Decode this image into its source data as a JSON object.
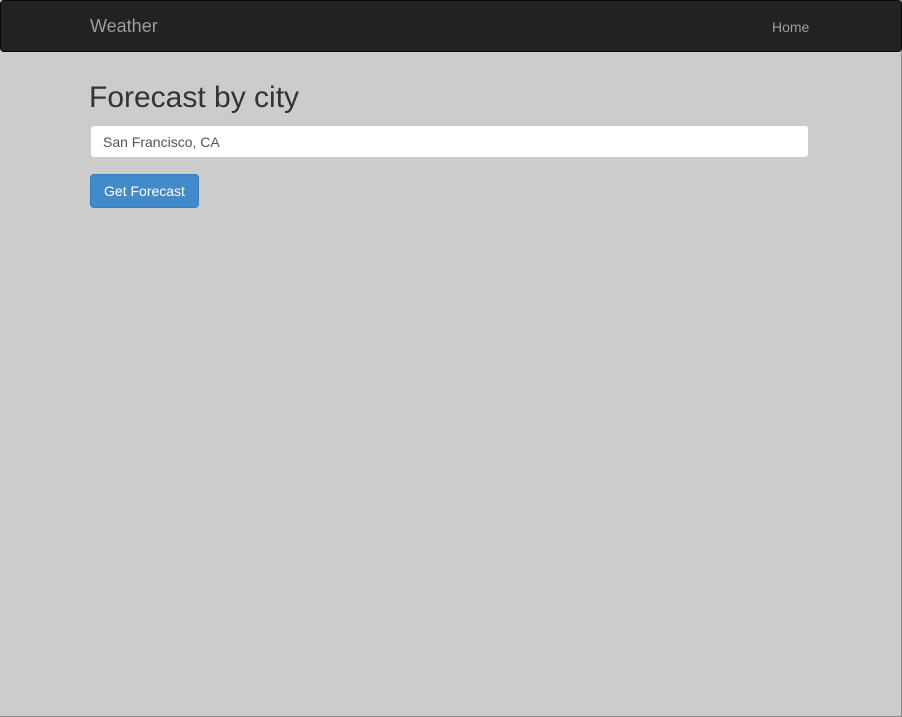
{
  "navbar": {
    "brand": "Weather",
    "links": [
      {
        "label": "Home"
      }
    ],
    "background_color": "#222222",
    "link_color": "#9d9d9d"
  },
  "main": {
    "title": "Forecast by city",
    "city_input": {
      "value": "San Francisco, CA"
    },
    "submit_button": {
      "label": "Get Forecast",
      "color": "#428bca"
    }
  },
  "page": {
    "background_color": "#cccccc"
  }
}
